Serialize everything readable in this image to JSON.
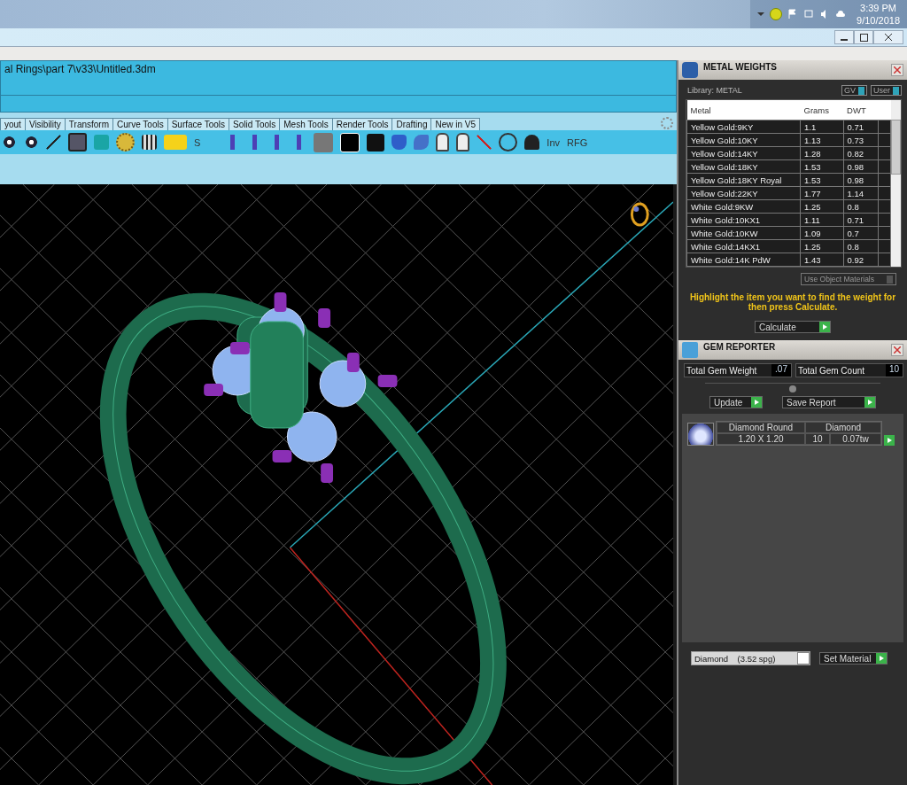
{
  "taskbar": {
    "time": "3:39 PM",
    "date": "9/10/2018"
  },
  "command": {
    "path_line": "al Rings\\part 7\\v33\\Untitled.3dm"
  },
  "tabs": [
    {
      "label": "yout",
      "selected": false
    },
    {
      "label": "Visibility",
      "selected": false
    },
    {
      "label": "Transform",
      "selected": false
    },
    {
      "label": "Curve Tools",
      "selected": false
    },
    {
      "label": "Surface Tools",
      "selected": false
    },
    {
      "label": "Solid Tools",
      "selected": false
    },
    {
      "label": "Mesh Tools",
      "selected": false
    },
    {
      "label": "Render Tools",
      "selected": false
    },
    {
      "label": "Drafting",
      "selected": false
    },
    {
      "label": "New in V5",
      "selected": false
    }
  ],
  "toolbar_texts": {
    "s": "S",
    "inv": "Inv",
    "rfg": "RFG"
  },
  "metal_weights": {
    "title": "METAL WEIGHTS",
    "library": "Library: METAL",
    "toggles": [
      {
        "label": "GV",
        "on": true
      },
      {
        "label": "User",
        "on": true
      }
    ],
    "columns": [
      "Metal",
      "Grams",
      "DWT"
    ],
    "rows": [
      [
        "Yellow Gold:9KY",
        "1.1",
        "0.71"
      ],
      [
        "Yellow Gold:10KY",
        "1.13",
        "0.73"
      ],
      [
        "Yellow Gold:14KY",
        "1.28",
        "0.82"
      ],
      [
        "Yellow Gold:18KY",
        "1.53",
        "0.98"
      ],
      [
        "Yellow Gold:18KY Royal",
        "1.53",
        "0.98"
      ],
      [
        "Yellow Gold:22KY",
        "1.77",
        "1.14"
      ],
      [
        "White Gold:9KW",
        "1.25",
        "0.8"
      ],
      [
        "White Gold:10KX1",
        "1.11",
        "0.71"
      ],
      [
        "White Gold:10KW",
        "1.09",
        "0.7"
      ],
      [
        "White Gold:14KX1",
        "1.25",
        "0.8"
      ],
      [
        "White Gold:14K PdW",
        "1.43",
        "0.92"
      ]
    ],
    "use_object_materials": {
      "label": "Use Object Materials",
      "on": false
    },
    "hint": "Highlight the item you want to find the weight for then press Calculate.",
    "calculate": "Calculate"
  },
  "gem_reporter": {
    "title": "GEM REPORTER",
    "weight_label": "Total Gem Weight",
    "weight": ".07",
    "count_label": "Total Gem Count",
    "count": "10",
    "update": "Update",
    "save_report": "Save Report",
    "gems": [
      {
        "shape": "Diamond Round",
        "material": "Diamond",
        "size": "1.20 X 1.20",
        "count": "10",
        "weight": "0.07tw"
      }
    ],
    "material_select": "Diamond    (3.52 spg)",
    "set_material": "Set Material"
  }
}
